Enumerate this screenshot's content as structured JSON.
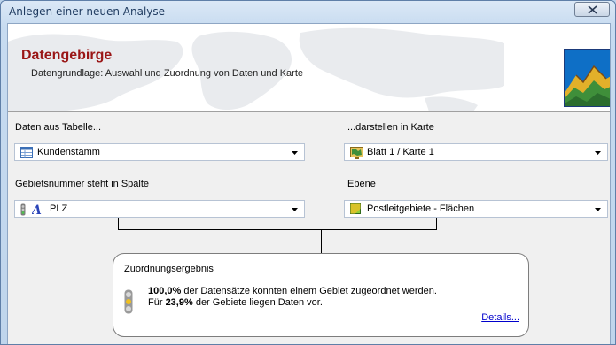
{
  "window": {
    "title": "Anlegen einer neuen Analyse"
  },
  "header": {
    "title": "Datengebirge",
    "subtitle": "Datengrundlage: Auswahl und Zuordnung von Daten und Karte"
  },
  "left": {
    "table_label": "Daten aus Tabelle...",
    "table_value": "Kundenstamm",
    "column_label": "Gebietsnummer steht in Spalte",
    "column_value": "PLZ"
  },
  "right": {
    "map_label": "...darstellen in Karte",
    "map_value": "Blatt 1 / Karte 1",
    "layer_label": "Ebene",
    "layer_value": "Postleitgebiete - Flächen"
  },
  "result": {
    "title": "Zuordnungsergebnis",
    "line1_value": "100,0%",
    "line1_text": " der Datensätze konnten einem Gebiet zugeordnet werden.",
    "line2_prefix": "Für ",
    "line2_value": "23,9%",
    "line2_text": " der Gebiete liegen Daten vor.",
    "details_link": "Details..."
  }
}
